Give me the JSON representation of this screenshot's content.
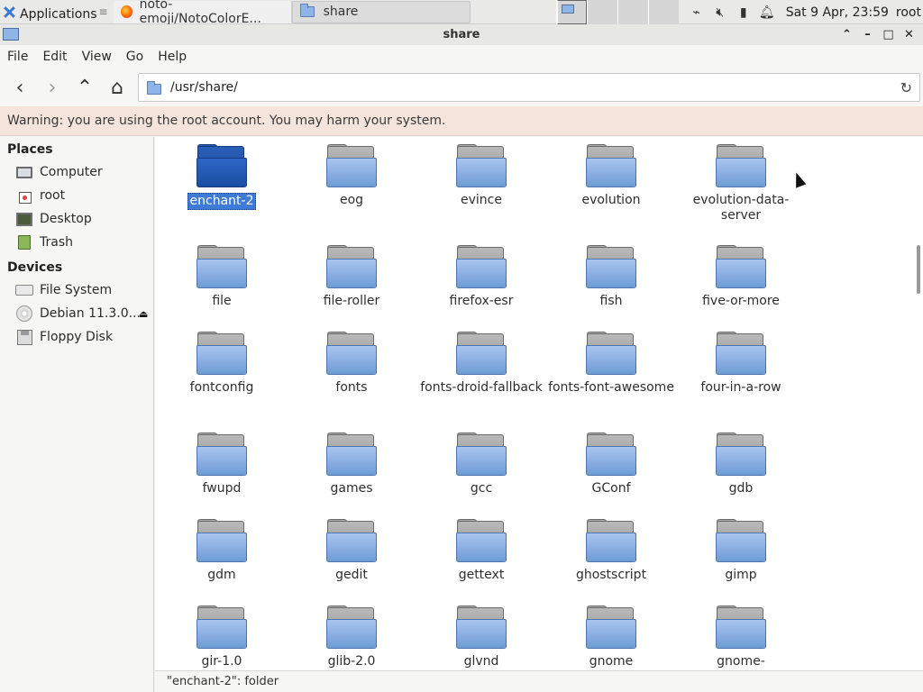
{
  "panel": {
    "applications_label": "Applications",
    "applications_sep": "≡",
    "tasks": [
      {
        "label": "noto-emoji/NotoColorE..."
      },
      {
        "label": "share"
      }
    ],
    "clock": "Sat  9 Apr, 23:59",
    "user": "root"
  },
  "window": {
    "title": "share"
  },
  "menu": {
    "file": "File",
    "edit": "Edit",
    "view": "View",
    "go": "Go",
    "help": "Help"
  },
  "location": {
    "path": "/usr/share/"
  },
  "warning": "Warning: you are using the root account. You may harm your system.",
  "sidebar": {
    "places_title": "Places",
    "places": [
      {
        "label": "Computer",
        "icon": "computer-icon"
      },
      {
        "label": "root",
        "icon": "home-icon"
      },
      {
        "label": "Desktop",
        "icon": "desktop-icon"
      },
      {
        "label": "Trash",
        "icon": "trash-icon"
      }
    ],
    "devices_title": "Devices",
    "devices": [
      {
        "label": "File System",
        "icon": "drive-icon"
      },
      {
        "label": "Debian 11.3.0...",
        "icon": "disc-icon"
      },
      {
        "label": "Floppy Disk",
        "icon": "floppy-icon"
      }
    ]
  },
  "folders": [
    {
      "label": "enchant-2",
      "selected": true
    },
    {
      "label": "eog"
    },
    {
      "label": "evince"
    },
    {
      "label": "evolution"
    },
    {
      "label": "evolution-data-\nserver"
    },
    {
      "label": "file"
    },
    {
      "label": "file-roller"
    },
    {
      "label": "firefox-esr"
    },
    {
      "label": "fish"
    },
    {
      "label": "five-or-more"
    },
    {
      "label": "fontconfig"
    },
    {
      "label": "fonts"
    },
    {
      "label": "fonts-droid-fallback"
    },
    {
      "label": "fonts-font-awesome"
    },
    {
      "label": "four-in-a-row"
    },
    {
      "label": "fwupd"
    },
    {
      "label": "games"
    },
    {
      "label": "gcc"
    },
    {
      "label": "GConf"
    },
    {
      "label": "gdb"
    },
    {
      "label": "gdm"
    },
    {
      "label": "gedit"
    },
    {
      "label": "gettext"
    },
    {
      "label": "ghostscript"
    },
    {
      "label": "gimp"
    },
    {
      "label": "gir-1.0"
    },
    {
      "label": "glib-2.0"
    },
    {
      "label": "glvnd"
    },
    {
      "label": "gnome"
    },
    {
      "label": "gnome-background-"
    }
  ],
  "status": "\"enchant-2\": folder",
  "colors": {
    "selection": "#3e7bd9",
    "warning_bg": "#f4e4dc",
    "folder_blue": "#8fb5e8"
  }
}
